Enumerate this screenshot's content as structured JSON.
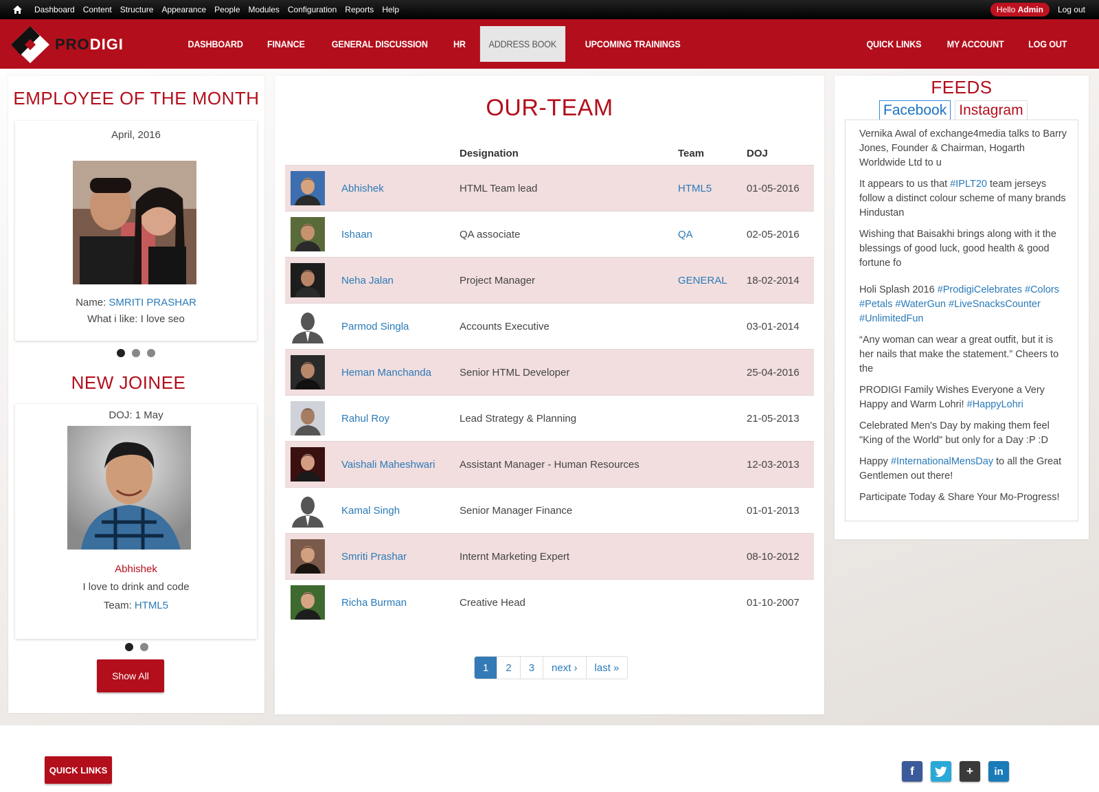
{
  "admin_bar": {
    "menu": [
      "Dashboard",
      "Content",
      "Structure",
      "Appearance",
      "People",
      "Modules",
      "Configuration",
      "Reports",
      "Help"
    ],
    "hello_prefix": "Hello",
    "hello_user": "Admin",
    "logout": "Log out"
  },
  "header": {
    "logo_pro": "PRO",
    "logo_digi": "DIGI",
    "nav": [
      "DASHBOARD",
      "FINANCE",
      "GENERAL DISCUSSION",
      "HR",
      "ADDRESS BOOK",
      "UPCOMING TRAININGS"
    ],
    "active_nav": "ADDRESS BOOK",
    "nav_right": [
      "QUICK LINKS",
      "MY ACCOUNT",
      "LOG OUT"
    ]
  },
  "employee_of_month": {
    "title": "EMPLOYEE OF THE MONTH",
    "date": "April, 2016",
    "name_label": "Name:",
    "name": "SMRITI PRASHAR",
    "like": "What i like: I love seo"
  },
  "new_joinee": {
    "title": "NEW JOINEE",
    "doj": "DOJ: 1 May",
    "name": "Abhishek",
    "like": "I love to drink and code",
    "team_label": "Team:",
    "team": "HTML5",
    "show_all": "Show All"
  },
  "team": {
    "title": "OUR-TEAM",
    "headers": [
      "Designation",
      "Team",
      "DOJ"
    ],
    "rows": [
      {
        "name": "Abhishek",
        "designation": "HTML Team lead",
        "team": "HTML5",
        "doj": "01-05-2016"
      },
      {
        "name": "Ishaan",
        "designation": "QA associate",
        "team": "QA",
        "doj": "02-05-2016"
      },
      {
        "name": "Neha Jalan",
        "designation": "Project Manager",
        "team": "GENERAL",
        "doj": "18-02-2014"
      },
      {
        "name": "Parmod Singla",
        "designation": "Accounts Executive",
        "team": "",
        "doj": "03-01-2014"
      },
      {
        "name": "Heman Manchanda",
        "designation": "Senior HTML Developer",
        "team": "",
        "doj": "25-04-2016"
      },
      {
        "name": "Rahul Roy",
        "designation": "Lead Strategy & Planning",
        "team": "",
        "doj": "21-05-2013"
      },
      {
        "name": "Vaishali Maheshwari",
        "designation": "Assistant Manager - Human Resources",
        "team": "",
        "doj": "12-03-2013"
      },
      {
        "name": "Kamal Singh",
        "designation": "Senior Manager Finance",
        "team": "",
        "doj": "01-01-2013"
      },
      {
        "name": "Smriti Prashar",
        "designation": "Internt Marketing Expert",
        "team": "",
        "doj": "08-10-2012"
      },
      {
        "name": "Richa Burman",
        "designation": "Creative Head",
        "team": "",
        "doj": "01-10-2007"
      }
    ],
    "pager": [
      "1",
      "2",
      "3",
      "next ›",
      "last »"
    ]
  },
  "feeds": {
    "title": "FEEDS",
    "tabs": [
      "Facebook",
      "Instagram"
    ],
    "items": [
      {
        "text": "Vernika Awal of exchange4media talks to Barry Jones, Founder & Chairman, Hogarth Worldwide Ltd to u"
      },
      {
        "pre": "It appears to us that ",
        "tag": "#IPLT20",
        "post": " team jerseys follow a distinct colour scheme of many brands Hindustan"
      },
      {
        "text": "Wishing that Baisakhi brings along with it the blessings of good luck, good health & good fortune fo"
      },
      {
        "pre": "Holi Splash 2016 ",
        "tag": "#ProdigiCelebrates #Colors #Petals #WaterGun #LiveSnacksCounter #UnlimitedFun",
        "post": ""
      },
      {
        "text": "“Any woman can wear a great outfit, but it is her nails that make the statement.” Cheers to the"
      },
      {
        "pre": "PRODIGI Family Wishes Everyone a Very Happy and Warm Lohri! ",
        "tag": "#HappyLohri",
        "post": ""
      },
      {
        "text": "Celebrated Men's Day by making them feel \"King of the World\" but only for a Day :P :D"
      },
      {
        "pre": "Happy ",
        "tag": "#InternationalMensDay",
        "post": " to all the Great Gentlemen out there!"
      },
      {
        "text": "Participate Today & Share Your Mo-Progress!"
      }
    ]
  },
  "footer": {
    "quick_links": "QUICK LINKS",
    "social": [
      "facebook-icon",
      "twitter-icon",
      "google-plus-icon",
      "linkedin-icon"
    ]
  },
  "colors": {
    "brand_red": "#b30e1b",
    "link_blue": "#2a7ab8",
    "row_pink": "#f2dede"
  }
}
